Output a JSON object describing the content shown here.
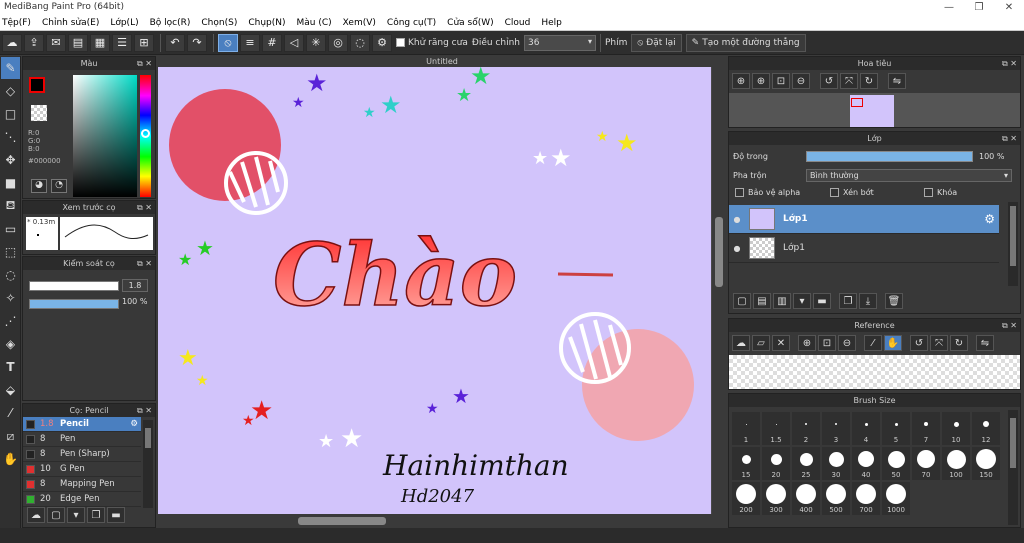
{
  "app": {
    "title": "MediBang Paint Pro (64bit)"
  },
  "menu": [
    "Tệp(F)",
    "Chỉnh sửa(E)",
    "Lớp(L)",
    "Bộ lọc(R)",
    "Chọn(S)",
    "Chụp(N)",
    "Màu (C)",
    "Xem(V)",
    "Công cụ(T)",
    "Cửa sổ(W)",
    "Cloud",
    "Help"
  ],
  "toolbar": {
    "antialias_label": "Khử răng cưa",
    "adjust_label": "Điều chỉnh",
    "adjust_value": "36",
    "key_label": "Phím",
    "reset_label": "Đặt lại",
    "line_label": "Tạo một đường thẳng"
  },
  "color_panel": {
    "title": "Màu",
    "rgb": [
      "R:0",
      "G:0",
      "B:0"
    ],
    "hex": "#000000"
  },
  "brush_preview": {
    "title": "Xem trước cọ",
    "size": "0.13m"
  },
  "control": {
    "title": "Kiểm soát cọ",
    "size": "1.8",
    "opacity": "100 %"
  },
  "brush_list": {
    "title": "Cọ: Pencil",
    "items": [
      {
        "size": "1.8",
        "name": "Pencil",
        "color": "#222222",
        "selected": true
      },
      {
        "size": "8",
        "name": "Pen",
        "color": "#222222"
      },
      {
        "size": "8",
        "name": "Pen (Sharp)",
        "color": "#222222"
      },
      {
        "size": "10",
        "name": "G Pen",
        "color": "#e03030"
      },
      {
        "size": "8",
        "name": "Mapping Pen",
        "color": "#e03030"
      },
      {
        "size": "20",
        "name": "Edge Pen",
        "color": "#30b030"
      }
    ]
  },
  "canvas": {
    "tab": "Untitled",
    "text_main": "Chào",
    "signature": "Hainhimthan",
    "signature2": "Hd2047"
  },
  "navigator": {
    "title": "Hoa tiêu"
  },
  "layer": {
    "title": "Lớp",
    "opacity_label": "Độ trong",
    "opacity_value": "100 %",
    "blend_label": "Pha trộn",
    "blend_value": "Bình thường",
    "protect_alpha": "Bảo vệ alpha",
    "clipping": "Xén bớt",
    "lock": "Khóa",
    "layers": [
      {
        "name": "Lớp1",
        "selected": true
      },
      {
        "name": "Lớp1"
      }
    ]
  },
  "reference": {
    "title": "Reference"
  },
  "brush_size": {
    "title": "Brush Size",
    "sizes": [
      "1",
      "1.5",
      "2",
      "3",
      "4",
      "5",
      "7",
      "10",
      "12",
      "15",
      "20",
      "25",
      "30",
      "40",
      "50",
      "70",
      "100",
      "150",
      "200",
      "300",
      "400",
      "500",
      "700",
      "1000"
    ]
  }
}
